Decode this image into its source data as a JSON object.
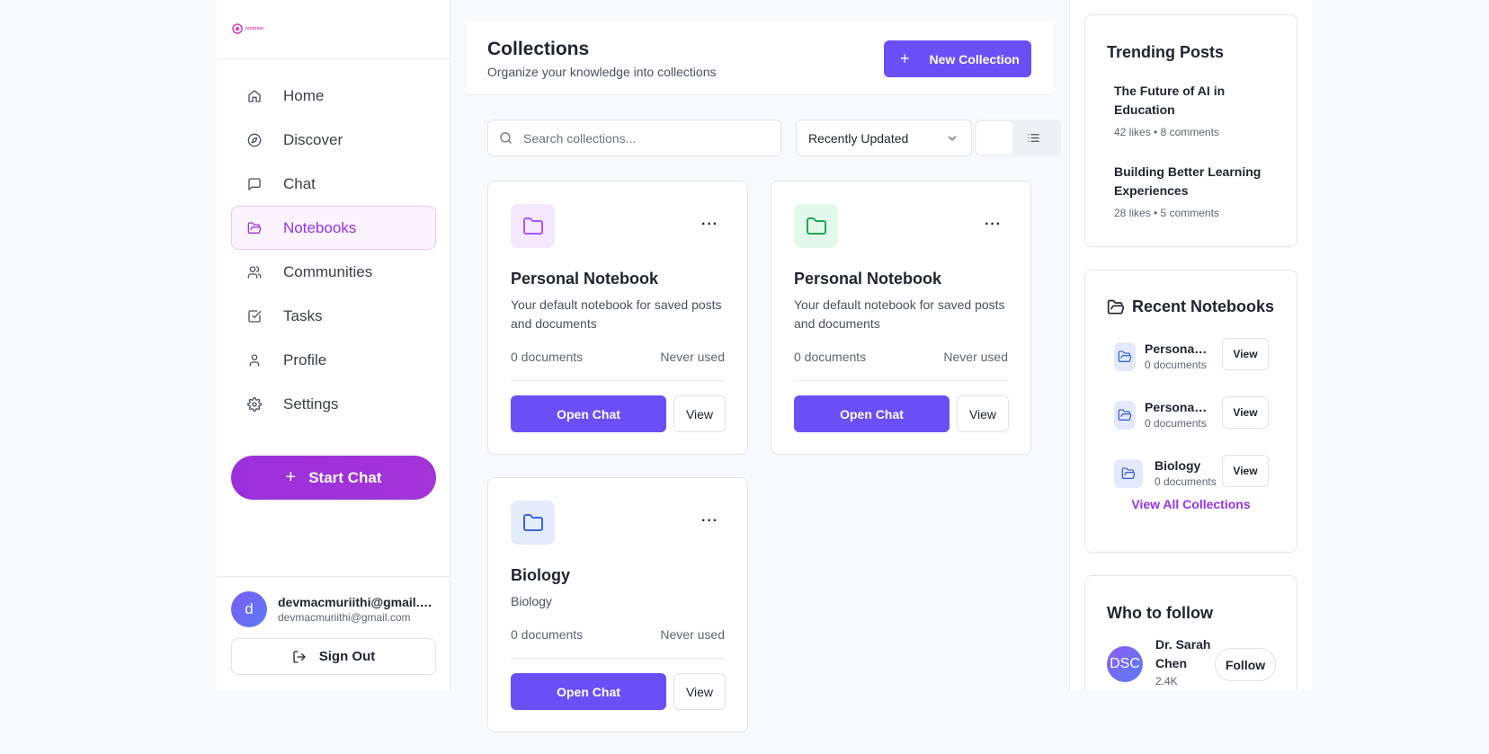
{
  "brand": {
    "logo_text": "recursor",
    "accent": "#9333ea",
    "primary": "#6a4ff6"
  },
  "sidebar": {
    "items": [
      {
        "label": "Home",
        "icon": "home-icon"
      },
      {
        "label": "Discover",
        "icon": "compass-icon"
      },
      {
        "label": "Chat",
        "icon": "message-icon"
      },
      {
        "label": "Notebooks",
        "icon": "folder-open-icon",
        "active": true
      },
      {
        "label": "Communities",
        "icon": "users-icon"
      },
      {
        "label": "Tasks",
        "icon": "checkbox-icon"
      },
      {
        "label": "Profile",
        "icon": "user-icon"
      },
      {
        "label": "Settings",
        "icon": "gear-icon"
      }
    ],
    "start_chat": "Start Chat",
    "user": {
      "initial": "d",
      "name": "devmacmuriithi@gmail.com",
      "email": "devmacmuriithi@gmail.com"
    },
    "sign_out": "Sign Out"
  },
  "header": {
    "title": "Collections",
    "subtitle": "Organize your knowledge into collections",
    "new_collection": "New Collection"
  },
  "toolbar": {
    "search_placeholder": "Search collections...",
    "sort_value": "Recently Updated"
  },
  "collections": [
    {
      "title": "Personal Notebook",
      "description": "Your default notebook for saved posts and documents",
      "documents": "0 documents",
      "last_used": "Never used",
      "open_chat": "Open Chat",
      "view": "View",
      "icon_bg": "#f5e8fd",
      "icon_color": "#a855f7"
    },
    {
      "title": "Personal Notebook",
      "description": "Your default notebook for saved posts and documents",
      "documents": "0 documents",
      "last_used": "Never used",
      "open_chat": "Open Chat",
      "view": "View",
      "icon_bg": "#e2f8ea",
      "icon_color": "#22a55a"
    },
    {
      "title": "Biology",
      "description": "Biology",
      "documents": "0 documents",
      "last_used": "Never used",
      "open_chat": "Open Chat",
      "view": "View",
      "icon_bg": "#e4ebfb",
      "icon_color": "#3b63d9"
    }
  ],
  "trending": {
    "title": "Trending Posts",
    "posts": [
      {
        "title": "The Future of AI in Education",
        "meta": "42 likes • 8 comments"
      },
      {
        "title": "Building Better Learning Experiences",
        "meta": "28 likes • 5 comments"
      }
    ]
  },
  "recent": {
    "title": "Recent Notebooks",
    "items": [
      {
        "name": "Personal Notebook",
        "docs": "0 documents",
        "view": "View"
      },
      {
        "name": "Personal Notebook",
        "docs": "0 documents",
        "view": "View"
      },
      {
        "name": "Biology",
        "docs": "0 documents",
        "view": "View"
      }
    ],
    "view_all": "View All Collections"
  },
  "follow": {
    "title": "Who to follow",
    "people": [
      {
        "initials": "DSC",
        "name": "Dr. Sarah Chen",
        "followers": "2.4K",
        "button": "Follow"
      }
    ]
  }
}
